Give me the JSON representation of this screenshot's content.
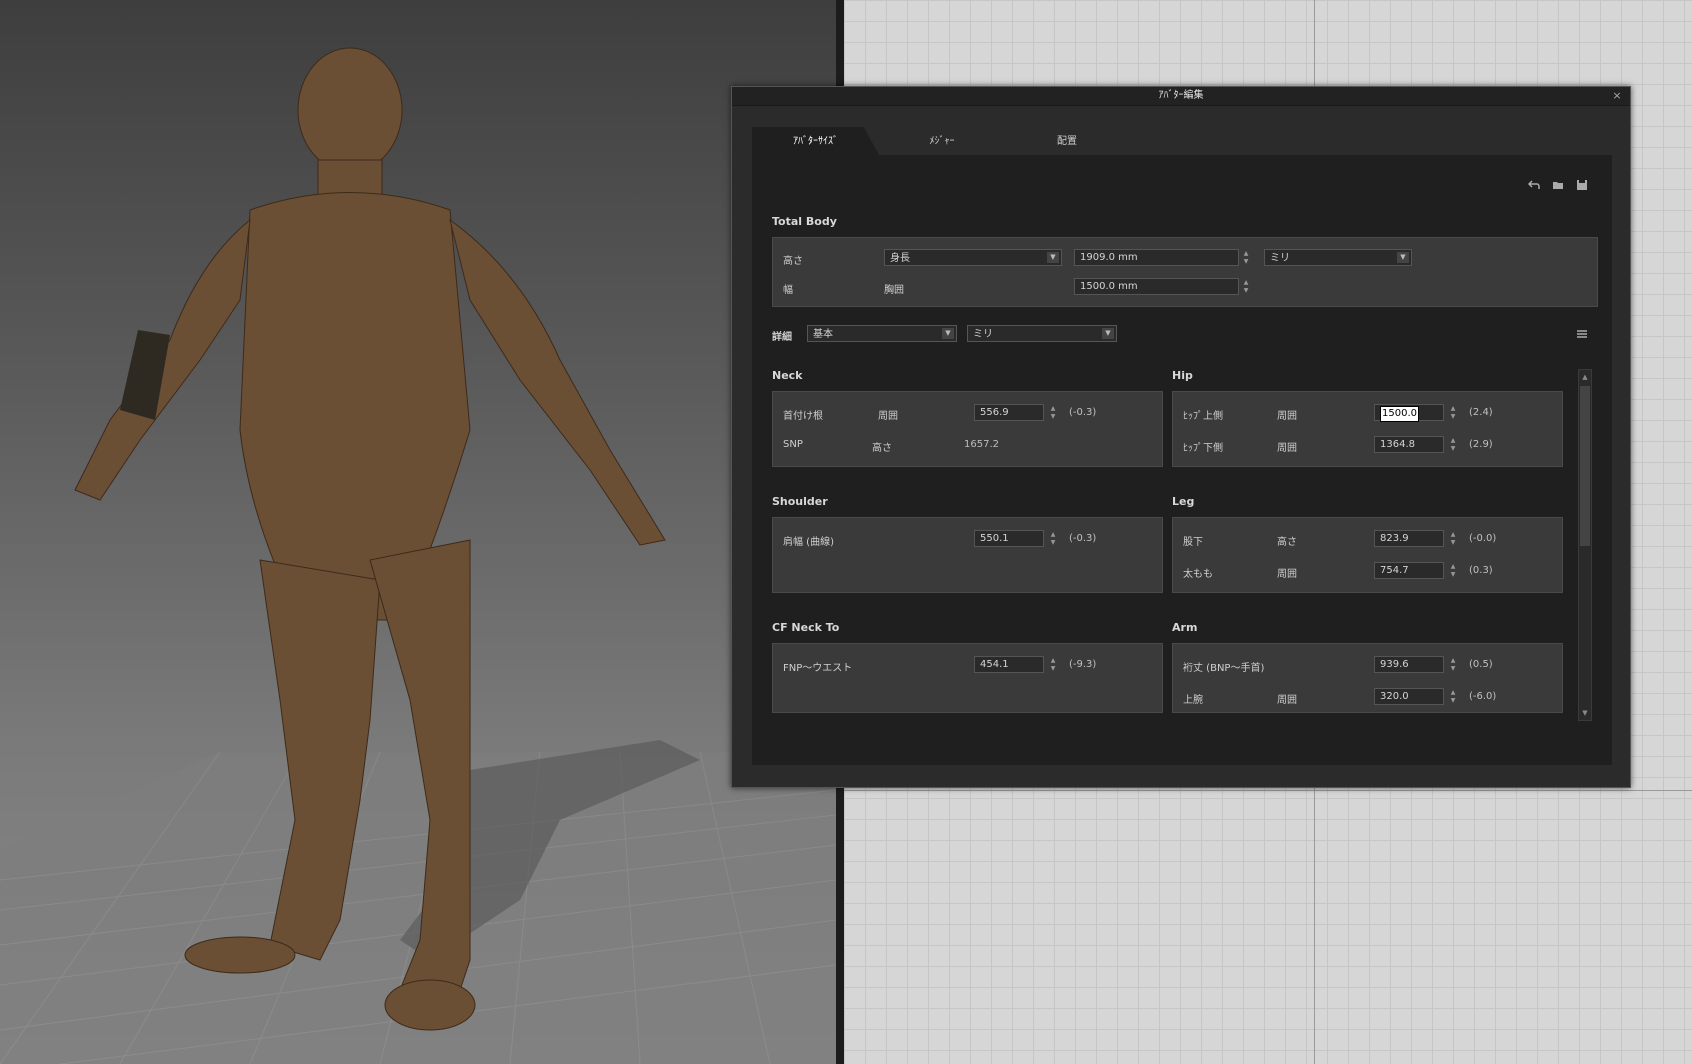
{
  "dialog": {
    "title": "ｱﾊﾞﾀｰ編集",
    "close_glyph": "×"
  },
  "tabs": [
    {
      "label": "ｱﾊﾞﾀｰｻｲｽﾞ",
      "active": true
    },
    {
      "label": "ﾒｼﾞｬｰ",
      "active": false
    },
    {
      "label": "配置",
      "active": false
    }
  ],
  "toolbar": {
    "icons": [
      "undo-icon",
      "folder-icon",
      "save-icon"
    ]
  },
  "total_body": {
    "title": "Total Body",
    "height_label": "高さ",
    "height_type": "身長",
    "height_value": "1909.0 mm",
    "unit": "ミリ",
    "width_label": "幅",
    "width_type": "胸囲",
    "width_value": "1500.0 mm"
  },
  "detail": {
    "label": "詳細",
    "mode": "基本",
    "unit": "ミリ"
  },
  "neck": {
    "title": "Neck",
    "row1": {
      "name": "首付け根",
      "type": "周囲",
      "value": "556.9",
      "delta": "(-0.3)"
    },
    "row2": {
      "name": "SNP",
      "type": "高さ",
      "value": "1657.2"
    }
  },
  "hip": {
    "title": "Hip",
    "row1": {
      "name": "ﾋｯﾌﾟ上側",
      "type": "周囲",
      "value": "1500.0",
      "delta": "(2.4)"
    },
    "row2": {
      "name": "ﾋｯﾌﾟ下側",
      "type": "周囲",
      "value": "1364.8",
      "delta": "(2.9)"
    }
  },
  "shoulder": {
    "title": "Shoulder",
    "row1": {
      "name": "肩幅 (曲線)",
      "value": "550.1",
      "delta": "(-0.3)"
    }
  },
  "leg": {
    "title": "Leg",
    "row1": {
      "name": "股下",
      "type": "高さ",
      "value": "823.9",
      "delta": "(-0.0)"
    },
    "row2": {
      "name": "太もも",
      "type": "周囲",
      "value": "754.7",
      "delta": "(0.3)"
    }
  },
  "cf_neck": {
    "title": "CF Neck To",
    "row1": {
      "name": "FNP～ウエスト",
      "value": "454.1",
      "delta": "(-9.3)"
    }
  },
  "arm": {
    "title": "Arm",
    "row1": {
      "name": "裄丈 (BNP～手首)",
      "value": "939.6",
      "delta": "(0.5)"
    },
    "row2": {
      "name": "上腕",
      "type": "周囲",
      "value": "320.0",
      "delta": "(-6.0)"
    }
  },
  "colors": {
    "dialog_bg": "#2b2b2b",
    "panel_bg": "#1f1f1f",
    "group_bg": "#3a3a3a",
    "avatar_skin": "#6b4f35"
  }
}
